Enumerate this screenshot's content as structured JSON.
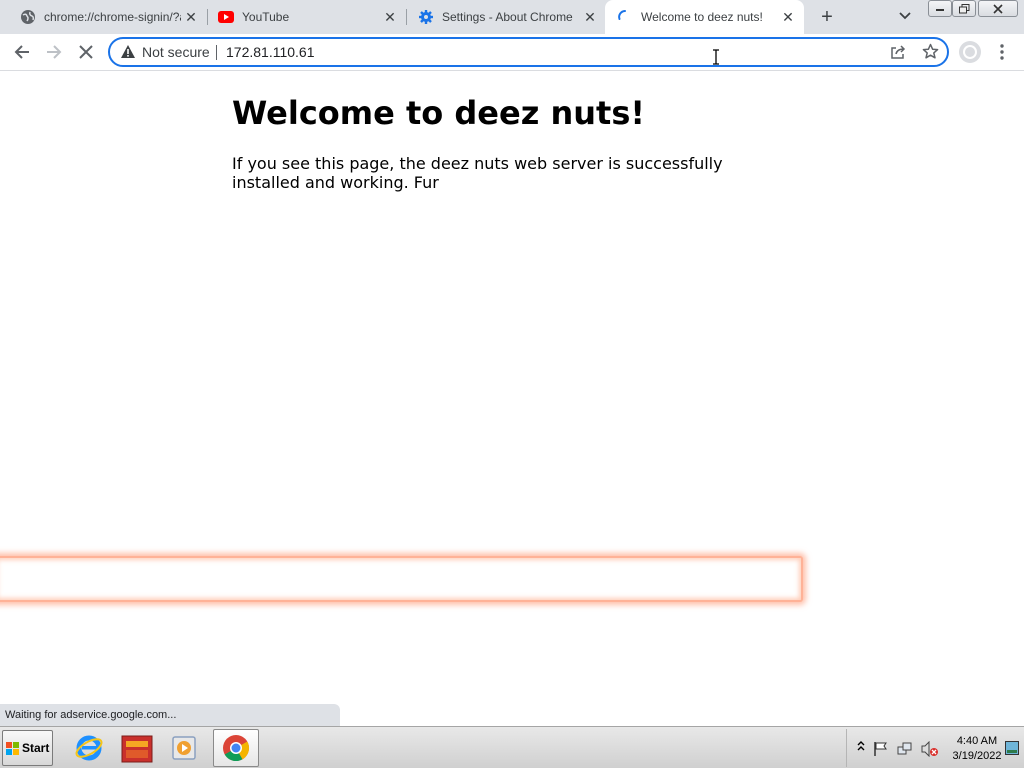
{
  "tabs": [
    {
      "title": "chrome://chrome-signin/?ac",
      "icon": "globe-icon",
      "active": false
    },
    {
      "title": "YouTube",
      "icon": "youtube-icon",
      "active": false
    },
    {
      "title": "Settings - About Chrome",
      "icon": "settings-gear-icon",
      "active": false
    },
    {
      "title": "Welcome to deez nuts!",
      "icon": "loading-spinner-icon",
      "active": true
    }
  ],
  "toolbar": {
    "security_status": "Not secure",
    "url": "172.81.110.61"
  },
  "page": {
    "heading": "Welcome to deez nuts!",
    "paragraph": "If you see this page, the deez nuts web server is successfully installed and working. Fur"
  },
  "status_bar": {
    "text": "Waiting for adservice.google.com..."
  },
  "taskbar": {
    "start_label": "Start",
    "apps": [
      "internet-explorer-icon",
      "file-manager-icon",
      "media-player-icon",
      "chrome-icon"
    ],
    "time": "4:40 AM",
    "date": "3/19/2022"
  },
  "colors": {
    "accent": "#1a73e8",
    "tabstrip": "#dee1e6",
    "glow": "#ff8c64"
  }
}
